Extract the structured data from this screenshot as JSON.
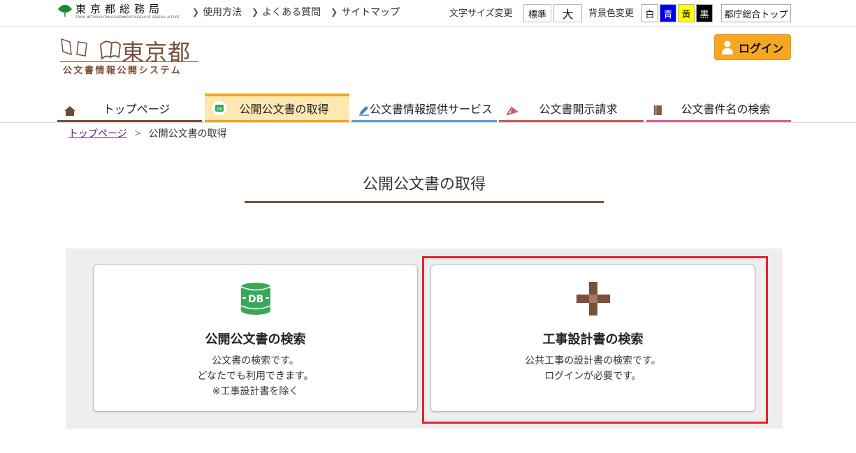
{
  "topbar": {
    "bureau_name": "東京都総務局",
    "bureau_sub": "TOKYO METROPOLITAN GOVERNMENT BUREAU OF GENERAL AFFAIRS",
    "links": [
      "使用方法",
      "よくある質問",
      "サイトマップ"
    ],
    "font_size_label": "文字サイズ変更",
    "font_std": "標準",
    "font_big": "大",
    "bg_label": "背景色変更",
    "bg_white": "白",
    "bg_blue": "青",
    "bg_yellow": "黄",
    "bg_black": "黒",
    "gov_top": "都庁総合トップ"
  },
  "logo": {
    "main": "東京都",
    "sub": "公文書情報公開システム"
  },
  "login_label": "ログイン",
  "nav": {
    "home": "トップページ",
    "get": "公開公文書の取得",
    "info": "公文書情報提供サービス",
    "request": "公文書開示請求",
    "name_search": "公文書件名の検索"
  },
  "breadcrumb": {
    "home": "トップページ",
    "sep": ">",
    "current": "公開公文書の取得"
  },
  "page_title": "公開公文書の取得",
  "cards": [
    {
      "icon_text": "DB",
      "title": "公開公文書の検索",
      "desc": [
        "公文書の検索です。",
        "どなたでも利用できます。",
        "※工事設計書を除く"
      ]
    },
    {
      "title": "工事設計書の検索",
      "desc": [
        "公共工事の設計書の検索です。",
        "ログインが必要です。"
      ]
    }
  ],
  "colors": {
    "brand_brown": "#7b4f3a",
    "login_orange": "#f5a623",
    "highlight_red": "#e3232c"
  }
}
